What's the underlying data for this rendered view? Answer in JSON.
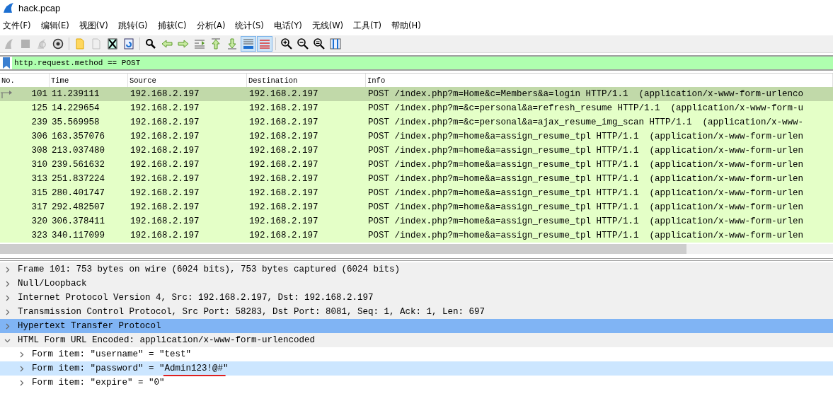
{
  "window": {
    "title": "hack.pcap"
  },
  "menu": [
    "文件(F)",
    "编辑(E)",
    "视图(V)",
    "跳转(G)",
    "捕获(C)",
    "分析(A)",
    "统计(S)",
    "电话(Y)",
    "无线(W)",
    "工具(T)",
    "帮助(H)"
  ],
  "toolbar": [
    {
      "kind": "fin",
      "disabled": true,
      "selected": false
    },
    {
      "kind": "stop",
      "disabled": true,
      "selected": false
    },
    {
      "kind": "restart",
      "disabled": true,
      "selected": false
    },
    {
      "kind": "options",
      "disabled": false,
      "selected": false
    },
    {
      "kind": "sep"
    },
    {
      "kind": "open",
      "disabled": false,
      "selected": false
    },
    {
      "kind": "save",
      "disabled": true,
      "selected": false
    },
    {
      "kind": "close",
      "disabled": false,
      "selected": false
    },
    {
      "kind": "reload",
      "disabled": false,
      "selected": false
    },
    {
      "kind": "sep"
    },
    {
      "kind": "find",
      "disabled": false,
      "selected": false
    },
    {
      "kind": "back",
      "disabled": false,
      "selected": false
    },
    {
      "kind": "forward",
      "disabled": false,
      "selected": false
    },
    {
      "kind": "goto",
      "disabled": false,
      "selected": false
    },
    {
      "kind": "first",
      "disabled": false,
      "selected": false
    },
    {
      "kind": "last",
      "disabled": false,
      "selected": false
    },
    {
      "kind": "autoscroll",
      "disabled": false,
      "selected": true
    },
    {
      "kind": "colorize",
      "disabled": false,
      "selected": true
    },
    {
      "kind": "sep"
    },
    {
      "kind": "zoomin",
      "disabled": false,
      "selected": false
    },
    {
      "kind": "zoomout",
      "disabled": false,
      "selected": false
    },
    {
      "kind": "zoomreset",
      "disabled": false,
      "selected": false
    },
    {
      "kind": "resize",
      "disabled": false,
      "selected": false
    }
  ],
  "filter": {
    "value": "http.request.method == POST"
  },
  "packet_list": {
    "columns": [
      "No.",
      "Time",
      "Source",
      "Destination",
      "Info"
    ],
    "rows": [
      {
        "no": "101",
        "time": "11.239111",
        "source": "192.168.2.197",
        "destination": "192.168.2.197",
        "info": "POST /index.php?m=Home&c=Members&a=login HTTP/1.1  (application/x-www-form-urlenco",
        "selected": true
      },
      {
        "no": "125",
        "time": "14.229654",
        "source": "192.168.2.197",
        "destination": "192.168.2.197",
        "info": "POST /index.php?m=&c=personal&a=refresh_resume HTTP/1.1  (application/x-www-form-u",
        "selected": false
      },
      {
        "no": "239",
        "time": "35.569958",
        "source": "192.168.2.197",
        "destination": "192.168.2.197",
        "info": "POST /index.php?m=&c=personal&a=ajax_resume_img_scan HTTP/1.1  (application/x-www-",
        "selected": false
      },
      {
        "no": "306",
        "time": "163.357076",
        "source": "192.168.2.197",
        "destination": "192.168.2.197",
        "info": "POST /index.php?m=home&a=assign_resume_tpl HTTP/1.1  (application/x-www-form-urlen",
        "selected": false
      },
      {
        "no": "308",
        "time": "213.037480",
        "source": "192.168.2.197",
        "destination": "192.168.2.197",
        "info": "POST /index.php?m=home&a=assign_resume_tpl HTTP/1.1  (application/x-www-form-urlen",
        "selected": false
      },
      {
        "no": "310",
        "time": "239.561632",
        "source": "192.168.2.197",
        "destination": "192.168.2.197",
        "info": "POST /index.php?m=home&a=assign_resume_tpl HTTP/1.1  (application/x-www-form-urlen",
        "selected": false
      },
      {
        "no": "313",
        "time": "251.837224",
        "source": "192.168.2.197",
        "destination": "192.168.2.197",
        "info": "POST /index.php?m=home&a=assign_resume_tpl HTTP/1.1  (application/x-www-form-urlen",
        "selected": false
      },
      {
        "no": "315",
        "time": "280.401747",
        "source": "192.168.2.197",
        "destination": "192.168.2.197",
        "info": "POST /index.php?m=home&a=assign_resume_tpl HTTP/1.1  (application/x-www-form-urlen",
        "selected": false
      },
      {
        "no": "317",
        "time": "292.482507",
        "source": "192.168.2.197",
        "destination": "192.168.2.197",
        "info": "POST /index.php?m=home&a=assign_resume_tpl HTTP/1.1  (application/x-www-form-urlen",
        "selected": false
      },
      {
        "no": "320",
        "time": "306.378411",
        "source": "192.168.2.197",
        "destination": "192.168.2.197",
        "info": "POST /index.php?m=home&a=assign_resume_tpl HTTP/1.1  (application/x-www-form-urlen",
        "selected": false
      },
      {
        "no": "323",
        "time": "340.117099",
        "source": "192.168.2.197",
        "destination": "192.168.2.197",
        "info": "POST /index.php?m=home&a=assign_resume_tpl HTTP/1.1  (application/x-www-form-urlen",
        "selected": false
      }
    ]
  },
  "details": [
    {
      "text": "Frame 101: 753 bytes on wire (6024 bits), 753 bytes captured (6024 bits)",
      "expanded": false,
      "selected": false
    },
    {
      "text": "Null/Loopback",
      "expanded": false,
      "selected": false
    },
    {
      "text": "Internet Protocol Version 4, Src: 192.168.2.197, Dst: 192.168.2.197",
      "expanded": false,
      "selected": false
    },
    {
      "text": "Transmission Control Protocol, Src Port: 58283, Dst Port: 8081, Seq: 1, Ack: 1, Len: 697",
      "expanded": false,
      "selected": false
    },
    {
      "text": "Hypertext Transfer Protocol",
      "expanded": false,
      "selected": true
    },
    {
      "text": "HTML Form URL Encoded: application/x-www-form-urlencoded",
      "expanded": true,
      "selected": false,
      "children": [
        {
          "text": "Form item: \"username\" = ",
          "value": "\"test\"",
          "selected": false,
          "underlined": false
        },
        {
          "text": "Form item: \"password\" = ",
          "value": "\"Admin123!@#\"",
          "selected": true,
          "underlined": true
        },
        {
          "text": "Form item: \"expire\" = ",
          "value": "\"0\"",
          "selected": false,
          "underlined": false
        }
      ]
    }
  ]
}
